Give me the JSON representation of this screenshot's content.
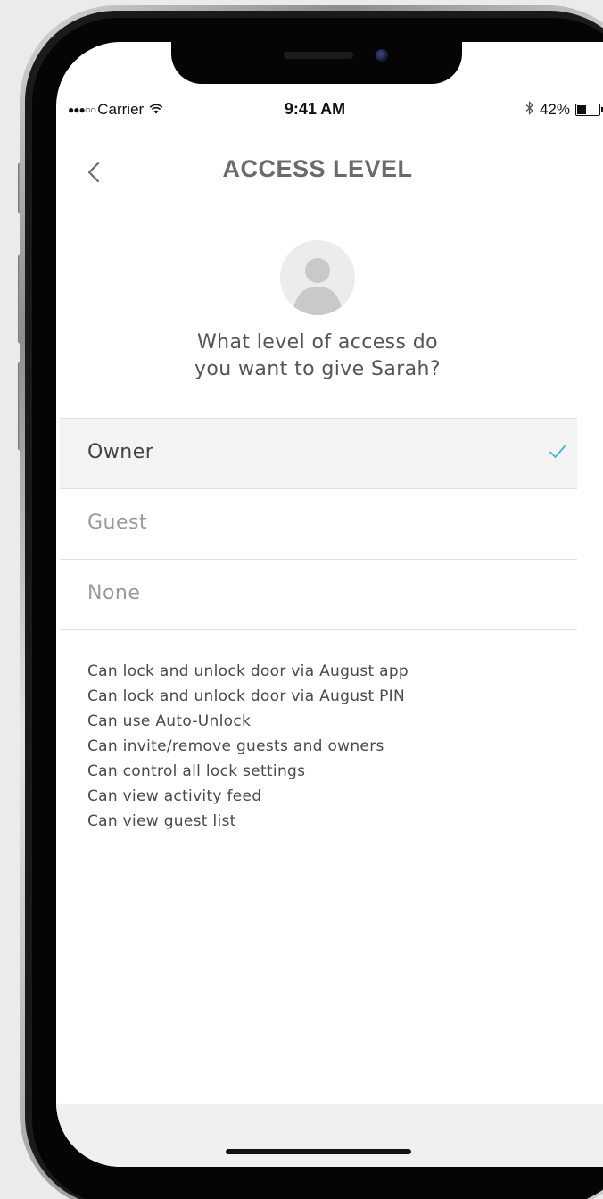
{
  "status_bar": {
    "carrier": "Carrier",
    "time": "9:41 AM",
    "battery_percent": "42%",
    "battery_level": 0.42
  },
  "header": {
    "title": "ACCESS LEVEL",
    "back_icon": "chevron-left-icon"
  },
  "avatar_icon": "user-silhouette-icon",
  "question": {
    "line1": "What level of access do",
    "line2": "you want to give Sarah?"
  },
  "options": [
    {
      "label": "Owner",
      "selected": true
    },
    {
      "label": "Guest",
      "selected": false
    },
    {
      "label": "None",
      "selected": false
    }
  ],
  "permissions": [
    "Can lock and unlock door via August app",
    "Can lock and unlock door via August PIN",
    "Can use Auto-Unlock",
    "Can invite/remove guests and owners",
    "Can control all lock settings",
    "Can view activity feed",
    "Can view guest list"
  ],
  "colors": {
    "accent": "#3fb8c9",
    "title": "#6b6b6b",
    "selected_row": "#f4f4f4",
    "muted_text": "#9a9a9a"
  }
}
